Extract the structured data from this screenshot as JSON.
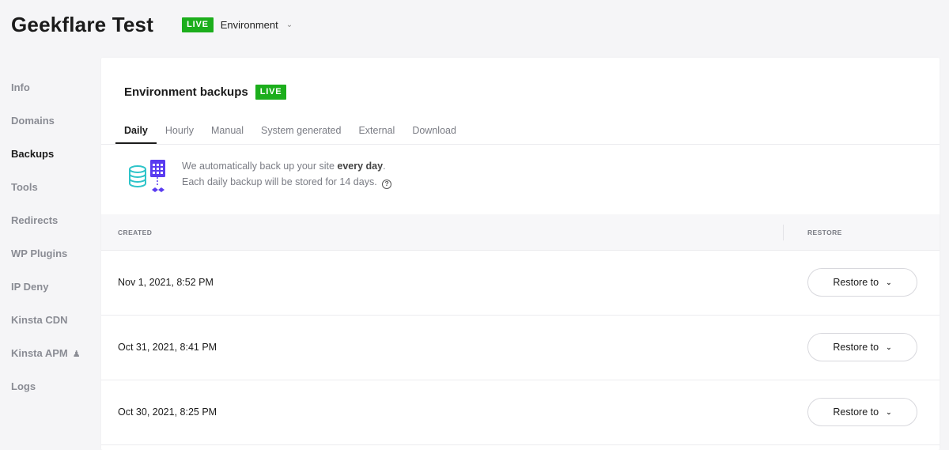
{
  "header": {
    "site_title": "Geekflare Test",
    "badge": "LIVE",
    "environment_label": "Environment"
  },
  "sidebar": {
    "items": [
      {
        "label": "Info"
      },
      {
        "label": "Domains"
      },
      {
        "label": "Backups",
        "active": true
      },
      {
        "label": "Tools"
      },
      {
        "label": "Redirects"
      },
      {
        "label": "WP Plugins"
      },
      {
        "label": "IP Deny"
      },
      {
        "label": "Kinsta CDN"
      },
      {
        "label": "Kinsta APM",
        "icon": "flask-icon"
      },
      {
        "label": "Logs"
      }
    ]
  },
  "card": {
    "title": "Environment backups",
    "badge": "LIVE",
    "tabs": [
      "Daily",
      "Hourly",
      "Manual",
      "System generated",
      "External",
      "Download"
    ],
    "info": {
      "line1_prefix": "We automatically back up your site ",
      "line1_bold": "every day",
      "line1_suffix": ".",
      "line2": "Each daily backup will be stored for 14 days.",
      "help_icon_glyph": "?"
    },
    "table": {
      "headers": {
        "created": "CREATED",
        "restore": "RESTORE"
      },
      "rows": [
        {
          "created": "Nov 1, 2021, 8:52 PM",
          "action": "Restore to"
        },
        {
          "created": "Oct 31, 2021, 8:41 PM",
          "action": "Restore to"
        },
        {
          "created": "Oct 30, 2021, 8:25 PM",
          "action": "Restore to"
        }
      ]
    }
  },
  "colors": {
    "live_badge": "#1cae1c",
    "text_dark": "#1b1b1b",
    "text_muted": "#7a7c84",
    "illustration_teal": "#2ec4c9",
    "illustration_purple": "#5a3cf0",
    "page_bg": "#f5f5f7"
  }
}
